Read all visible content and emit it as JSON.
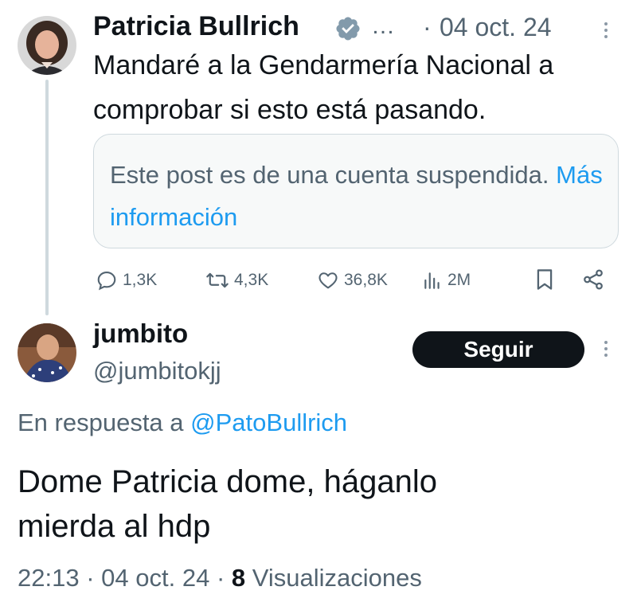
{
  "parent_tweet": {
    "author_name": "Patricia Bullrich",
    "ellipsis": "…",
    "separator": "·",
    "date": "04 oct. 24",
    "text_line1": "Mandaré a la Gendarmería Nacional a",
    "text_line2": "comprobar si esto está pasando.",
    "quoted_notice": "Este post es de una cuenta suspendida.",
    "quoted_link": "Más información",
    "actions": {
      "replies": "1,3K",
      "retweets": "4,3K",
      "likes": "36,8K",
      "views": "2M"
    }
  },
  "reply_tweet": {
    "author_name": "jumbito",
    "handle": "@jumbitokjj",
    "follow_label": "Seguir",
    "reply_prefix": "En respuesta a",
    "reply_handle": "@PatoBullrich",
    "text_line1": "Dome Patricia dome, háganlo",
    "text_line2": "mierda al hdp",
    "time": "22:13",
    "separator": "·",
    "date": "04 oct. 24",
    "views_count": "8",
    "views_label": "Visualizaciones"
  },
  "colors": {
    "text": "#0f1419",
    "secondary": "#536471",
    "link": "#1d9bf0",
    "verified": "#829aab",
    "border": "#cfd9de"
  }
}
